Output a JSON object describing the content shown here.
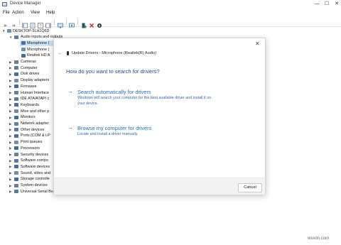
{
  "window": {
    "title": "Device Manager"
  },
  "menu": [
    "File",
    "Action",
    "View",
    "Help"
  ],
  "tree": {
    "root": "DESKTOP-5LH1Q6D",
    "nodes": [
      {
        "label": "Audio inputs and outputs",
        "icon": "audio-icon",
        "expanded": true,
        "level": 1
      },
      {
        "label": "Microphone (",
        "icon": "microphone-icon",
        "level": 2,
        "selected": true
      },
      {
        "label": "Microphone (",
        "icon": "microphone-icon",
        "level": 2
      },
      {
        "label": "Realtek HD A",
        "icon": "speaker-icon",
        "level": 2
      },
      {
        "label": "Cameras",
        "icon": "camera-icon",
        "level": 1
      },
      {
        "label": "Computer",
        "icon": "computer-icon",
        "level": 1
      },
      {
        "label": "Disk drives",
        "icon": "disk-icon",
        "level": 1
      },
      {
        "label": "Display adapters",
        "icon": "display-icon",
        "level": 1
      },
      {
        "label": "Firmware",
        "icon": "firmware-icon",
        "level": 1
      },
      {
        "label": "Human Interface",
        "icon": "hid-icon",
        "level": 1
      },
      {
        "label": "IDE ATA/ATAPI c",
        "icon": "ide-icon",
        "level": 1
      },
      {
        "label": "Keyboards",
        "icon": "keyboard-icon",
        "level": 1
      },
      {
        "label": "Mice and other p",
        "icon": "mouse-icon",
        "level": 1
      },
      {
        "label": "Monitors",
        "icon": "monitor-icon",
        "level": 1
      },
      {
        "label": "Network adapter",
        "icon": "network-icon",
        "level": 1
      },
      {
        "label": "Other devices",
        "icon": "other-devices-icon",
        "level": 1
      },
      {
        "label": "Ports (COM & LP",
        "icon": "port-icon",
        "level": 1
      },
      {
        "label": "Print queues",
        "icon": "printer-icon",
        "level": 1
      },
      {
        "label": "Processors",
        "icon": "processor-icon",
        "level": 1
      },
      {
        "label": "Security devices",
        "icon": "security-icon",
        "level": 1
      },
      {
        "label": "Software compo",
        "icon": "software-icon",
        "level": 1
      },
      {
        "label": "Software devices",
        "icon": "software-icon",
        "level": 1
      },
      {
        "label": "Sound, video and",
        "icon": "sound-icon",
        "level": 1
      },
      {
        "label": "Storage controlle",
        "icon": "storage-icon",
        "level": 1
      },
      {
        "label": "System devices",
        "icon": "system-icon",
        "level": 1
      },
      {
        "label": "Universal Serial Bus controllers",
        "icon": "usb-icon",
        "level": 1
      }
    ]
  },
  "dialog": {
    "title": "Update Drivers - Microphone (Realtek(R) Audio)",
    "question": "How do you want to search for drivers?",
    "options": [
      {
        "heading": "Search automatically for drivers",
        "description": "Windows will search your computer for the best available driver and install it on your device."
      },
      {
        "heading": "Browse my computer for drivers",
        "description": "Locate and install a driver manually."
      }
    ],
    "cancel_label": "Cancel"
  },
  "watermark": "wsxdn.com",
  "colors": {
    "accent": "#1e6fc4",
    "question": "#1a4d9c",
    "selection": "#cce4f7"
  }
}
